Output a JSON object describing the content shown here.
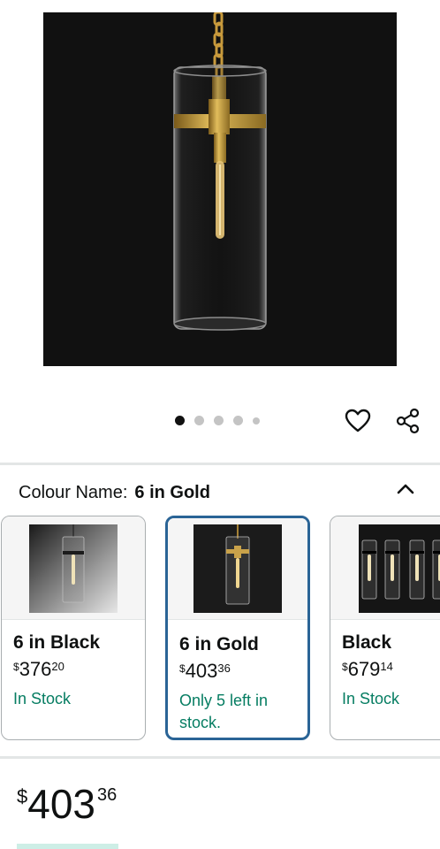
{
  "product": {
    "image_alt": "Cylindrical glass pendant light with gold band",
    "carousel": {
      "count": 5,
      "active_index": 0
    },
    "actions": {
      "wishlist_icon": "heart-icon",
      "share_icon": "share-icon"
    }
  },
  "colour": {
    "label": "Colour Name:",
    "value": "6 in Gold",
    "toggle_icon": "chevron-up-icon",
    "options": [
      {
        "name": "6 in Black",
        "currency": "$",
        "price_whole": "376",
        "price_cents": "20",
        "stock": "In Stock",
        "selected": false
      },
      {
        "name": "6 in Gold",
        "currency": "$",
        "price_whole": "403",
        "price_cents": "36",
        "stock": "Only 5 left in stock.",
        "selected": true
      },
      {
        "name": "Black",
        "currency": "$",
        "price_whole": "679",
        "price_cents": "14",
        "stock": "In Stock",
        "selected": false
      }
    ]
  },
  "price": {
    "currency": "$",
    "whole": "403",
    "cents": "36"
  },
  "colors": {
    "stock_green": "#067d62",
    "selected_border": "#2a6496",
    "brass": "#b8922f"
  }
}
